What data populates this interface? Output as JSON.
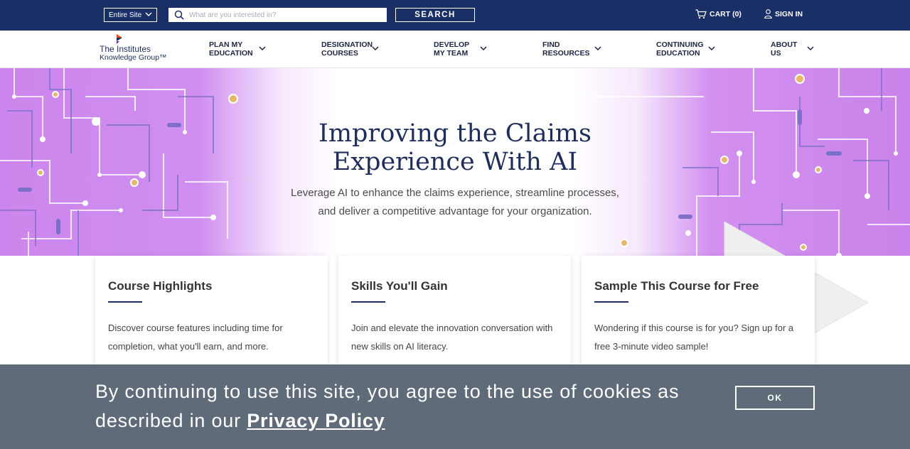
{
  "colors": {
    "topbar": "#1a2f66",
    "hero_purple": "#cc85ec",
    "title_navy": "#1f2d5c",
    "cookie_bg": "#5f6b78"
  },
  "topbar": {
    "scope_label": "Entire Site",
    "search_placeholder": "What are you interested in?",
    "search_button": "SEARCH",
    "cart_label": "CART (0)",
    "signin_label": "SIGN IN",
    "icons": [
      "chevron-down-icon",
      "search-icon",
      "cart-icon",
      "user-icon"
    ]
  },
  "logo": {
    "line1": "The Institutes",
    "line2": "Knowledge Group™"
  },
  "nav": {
    "items": [
      {
        "line1": "PLAN MY",
        "line2": "EDUCATION"
      },
      {
        "line1": "DESIGNATION",
        "line2": "COURSES"
      },
      {
        "line1": "DEVELOP",
        "line2": "MY TEAM"
      },
      {
        "line1": "FIND",
        "line2": "RESOURCES"
      },
      {
        "line1": "CONTINUING",
        "line2": "EDUCATION"
      },
      {
        "line1": "ABOUT",
        "line2": "US"
      }
    ]
  },
  "hero": {
    "title_line1": "Improving the Claims",
    "title_line2": "Experience With AI",
    "subtitle_line1": "Leverage AI to enhance the claims experience, streamline processes,",
    "subtitle_line2": "and deliver a competitive advantage for your organization."
  },
  "cards": [
    {
      "title": "Course Highlights",
      "line1": "Discover course features including time for",
      "line2": "completion, what you'll earn, and more."
    },
    {
      "title": "Skills You'll Gain",
      "line1": "Join and elevate the innovation conversation with",
      "line2": "new skills on AI literacy."
    },
    {
      "title": "Sample This Course for Free",
      "line1": "Wondering if this course is for you? Sign up for a",
      "line2": "free 3-minute video sample!"
    }
  ],
  "cookie": {
    "text_line1": "By continuing to use this site, you agree to the use of cookies as",
    "text_line2_prefix": "described in our ",
    "link_text": "Privacy Policy",
    "ok_label": "OK"
  }
}
